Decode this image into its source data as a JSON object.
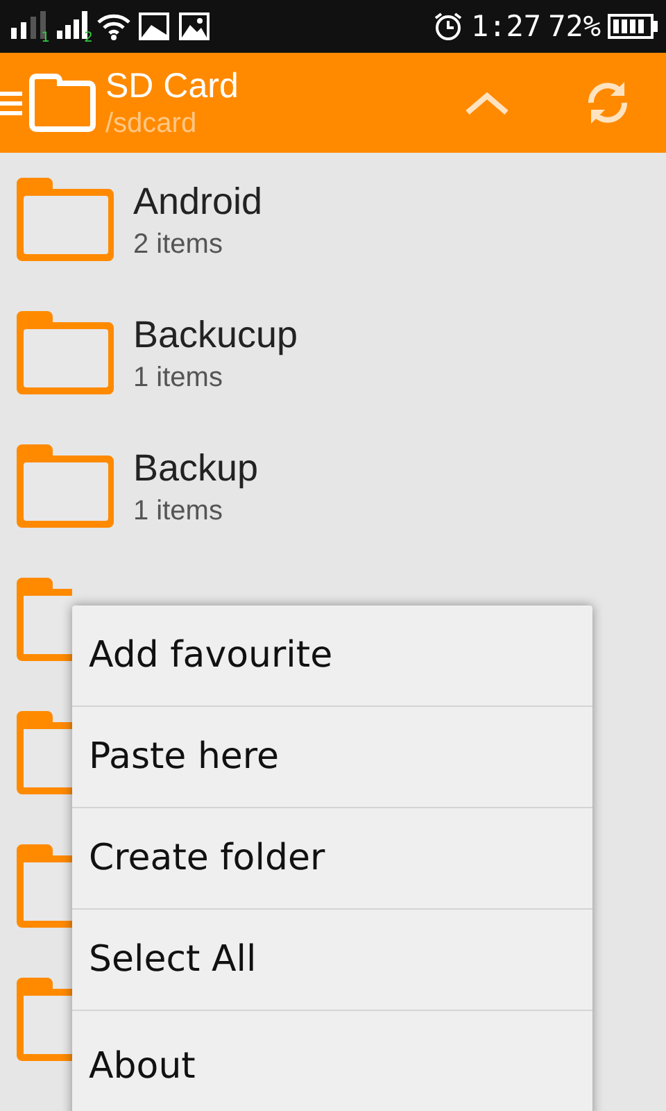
{
  "status_bar": {
    "time": "1:27",
    "battery": "72%",
    "sim_1": "1",
    "sim_2": "2"
  },
  "app_bar": {
    "title": "SD Card",
    "path": "/sdcard"
  },
  "folders": [
    {
      "kind": "folder",
      "name": "Android",
      "count": "2 items"
    },
    {
      "kind": "folder",
      "name": "Backucup",
      "count": "1 items"
    },
    {
      "kind": "folder",
      "name": "Backup",
      "count": "1 items"
    },
    {
      "kind": "covered"
    },
    {
      "kind": "covered"
    },
    {
      "kind": "covered"
    },
    {
      "kind": "covered"
    }
  ],
  "menu": [
    "Add favourite",
    "Paste here",
    "Create folder",
    "Select All",
    "About"
  ]
}
